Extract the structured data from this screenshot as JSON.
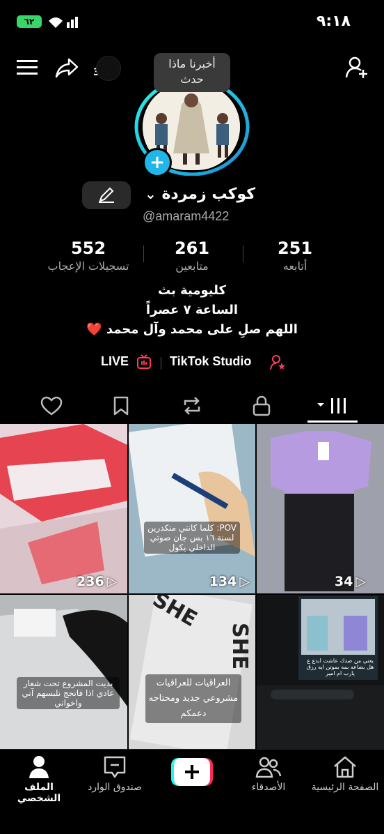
{
  "status_bar": {
    "time": "٩:١٨",
    "battery": "٦٢"
  },
  "top_bar": {
    "notification_count": "3"
  },
  "tooltip": {
    "line1": "أخبرنا ماذا",
    "line2": "حدث"
  },
  "profile": {
    "name": "كوكب زمردة",
    "username": "@amaram4422",
    "stats": [
      {
        "value": "251",
        "label": "أتابعه"
      },
      {
        "value": "261",
        "label": "متابعين"
      },
      {
        "value": "552",
        "label": "تسجيلات الإعجاب"
      }
    ],
    "bio": [
      "كليومية بث",
      "الساعة ٧ عصراً",
      "اللهم صلِ على محمد وآل محمد"
    ],
    "bio_heart": "❤️",
    "links": {
      "studio": "TikTok Studio",
      "live": "LIVE"
    }
  },
  "videos": [
    {
      "views": "34",
      "overlay": ""
    },
    {
      "views": "134",
      "overlay": "POV: كلما كانتي متكدرين لسنة ١٦ بس جان صوتي الداخلي يكول"
    },
    {
      "views": "236",
      "overlay": ""
    },
    {
      "views": "",
      "overlay": "يعني من صدك عاشت ابدع ع هل بضاعه بمه بموتن ايه رزق يارب ام امير"
    },
    {
      "views": "",
      "overlay": "العراقيات للعراقيات مشروعي جديد ومحتاجه دعمكم"
    },
    {
      "views": "",
      "overlay": "بديت المشروع تحت شعار عادي اذا فاتحج نلبسهم آني واخواتي"
    }
  ],
  "bottom_nav": {
    "home": "الصفحة الرئيسية",
    "friends": "الأصدقاء",
    "inbox": "صندوق الوارد",
    "profile": "الملف الشخصي"
  }
}
